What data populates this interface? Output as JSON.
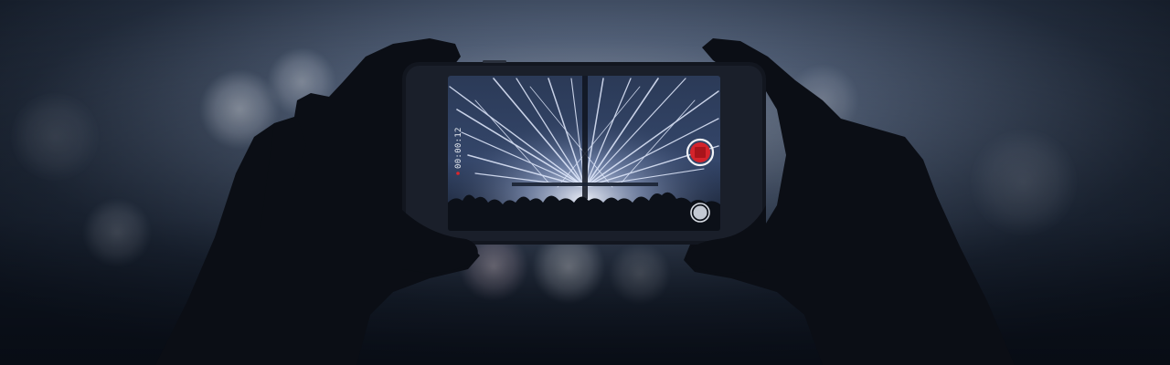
{
  "recording": {
    "elapsed_time": "00:00:12",
    "indicator_color": "#e0252a"
  },
  "palette": {
    "background_dark": "#0f1622",
    "haze_light": "#c9d4e6",
    "beam_color": "#dfe8ff",
    "silhouette": "#0a0d14",
    "record_button": "#d4232b"
  },
  "icons": {
    "stop_record": "stop-record-icon",
    "shutter": "shutter-icon",
    "recording_dot": "recording-dot-icon"
  }
}
